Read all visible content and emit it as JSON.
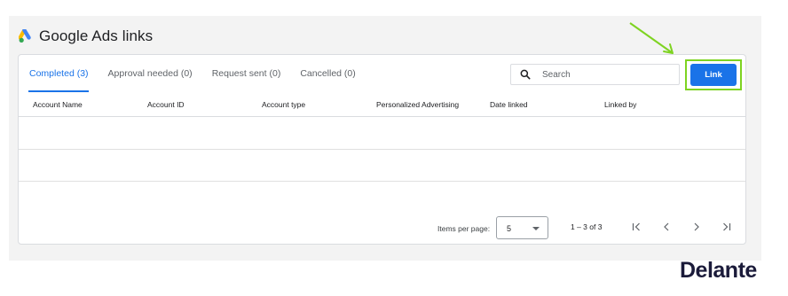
{
  "header": {
    "title": "Google Ads links",
    "logo_icon": "google-ads-logo"
  },
  "tabs": [
    {
      "label": "Completed (3)",
      "active": true
    },
    {
      "label": "Approval needed (0)",
      "active": false
    },
    {
      "label": "Request sent (0)",
      "active": false
    },
    {
      "label": "Cancelled (0)",
      "active": false
    }
  ],
  "search": {
    "placeholder": "Search",
    "icon": "search-icon"
  },
  "link_button": {
    "label": "Link"
  },
  "table": {
    "columns": [
      "Account Name",
      "Account ID",
      "Account type",
      "Personalized Advertising",
      "Date linked",
      "Linked by"
    ],
    "rows": [
      [
        "",
        "",
        "",
        "",
        "",
        ""
      ],
      [
        "",
        "",
        "",
        "",
        "",
        ""
      ],
      [
        "",
        "",
        "",
        "",
        "",
        ""
      ]
    ]
  },
  "pagination": {
    "items_per_page_label": "Items per page:",
    "items_per_page_value": "5",
    "range_text": "1 – 3 of 3"
  },
  "watermark": {
    "text": "Delante"
  },
  "colors": {
    "accent": "#1a73e8",
    "highlight": "#7ed321",
    "brand": "#1b1b3a"
  }
}
